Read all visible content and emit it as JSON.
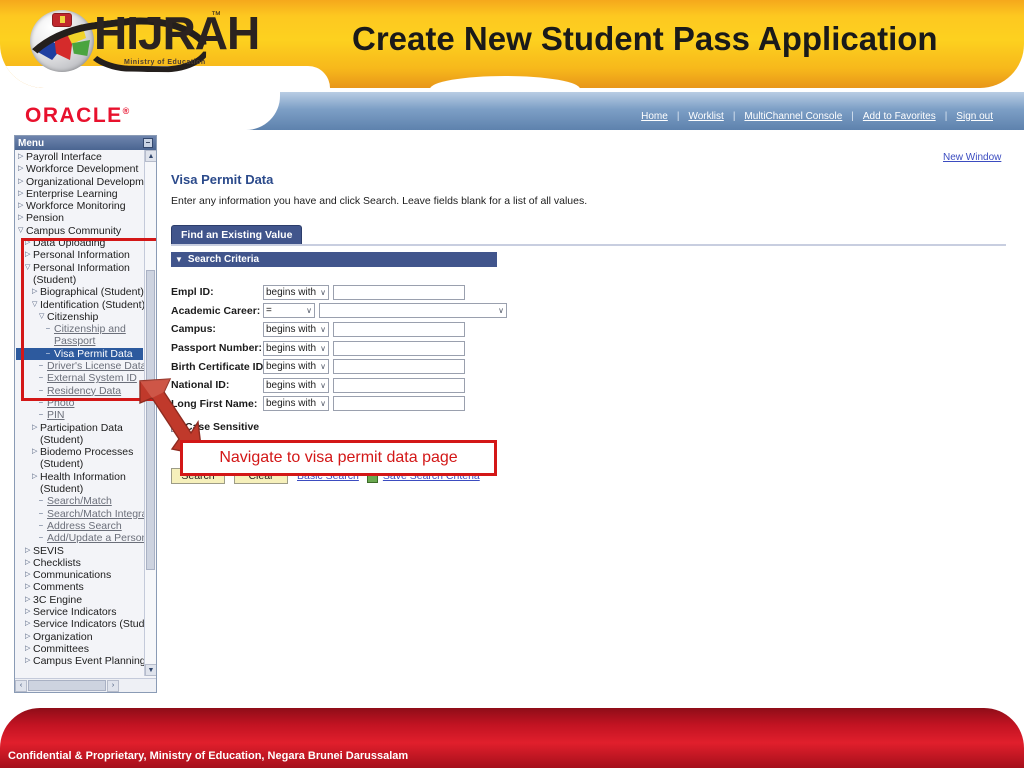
{
  "banner": {
    "title": "Create New Student Pass Application",
    "logo_text": "HIJRAH",
    "logo_tm": "™",
    "logo_sub": "Ministry of Education"
  },
  "oracle_bar": {
    "brand": "ORACLE",
    "brand_mark": "®",
    "links": [
      "Home",
      "Worklist",
      "MultiChannel Console",
      "Add to Favorites",
      "Sign out"
    ],
    "separator": "|"
  },
  "sidebar": {
    "header": "Menu",
    "collapse_glyph": "–",
    "scroll_up_glyph": "▲",
    "scroll_down_glyph": "▼",
    "hscroll_left_glyph": "‹",
    "hscroll_right_glyph": "›",
    "items": [
      {
        "label": "Payroll Interface",
        "indent": 1,
        "twisty": "▷",
        "kind": "node"
      },
      {
        "label": "Workforce Development",
        "indent": 1,
        "twisty": "▷",
        "kind": "node"
      },
      {
        "label": "Organizational Development",
        "indent": 1,
        "twisty": "▷",
        "kind": "node"
      },
      {
        "label": "Enterprise Learning",
        "indent": 1,
        "twisty": "▷",
        "kind": "node"
      },
      {
        "label": "Workforce Monitoring",
        "indent": 1,
        "twisty": "▷",
        "kind": "node"
      },
      {
        "label": "Pension",
        "indent": 1,
        "twisty": "▷",
        "kind": "node"
      },
      {
        "label": "Campus Community",
        "indent": 1,
        "twisty": "▽",
        "kind": "node"
      },
      {
        "label": "Data Uploading",
        "indent": 2,
        "twisty": "▷",
        "kind": "node"
      },
      {
        "label": "Personal Information",
        "indent": 2,
        "twisty": "▷",
        "kind": "node"
      },
      {
        "label": "Personal Information (Student)",
        "indent": 2,
        "twisty": "▽",
        "kind": "node",
        "wrap": true
      },
      {
        "label": "Biographical (Student)",
        "indent": 3,
        "twisty": "▷",
        "kind": "node"
      },
      {
        "label": "Identification (Student)",
        "indent": 3,
        "twisty": "▽",
        "kind": "node"
      },
      {
        "label": "Citizenship",
        "indent": 4,
        "twisty": "▽",
        "kind": "node"
      },
      {
        "label": "Citizenship and Passport",
        "indent": 5,
        "twisty": "–",
        "kind": "link",
        "wrap": true
      },
      {
        "label": "Visa Permit Data",
        "indent": 5,
        "twisty": "–",
        "kind": "selected"
      },
      {
        "label": "Driver's License Data",
        "indent": 4,
        "twisty": "–",
        "kind": "link"
      },
      {
        "label": "External System ID",
        "indent": 4,
        "twisty": "–",
        "kind": "link"
      },
      {
        "label": "Residency Data",
        "indent": 4,
        "twisty": "–",
        "kind": "link"
      },
      {
        "label": "Photo",
        "indent": 4,
        "twisty": "–",
        "kind": "link"
      },
      {
        "label": "PIN",
        "indent": 4,
        "twisty": "–",
        "kind": "link"
      },
      {
        "label": "Participation Data (Student)",
        "indent": 3,
        "twisty": "▷",
        "kind": "node",
        "wrap": true
      },
      {
        "label": "Biodemo Processes (Student)",
        "indent": 3,
        "twisty": "▷",
        "kind": "node",
        "wrap": true
      },
      {
        "label": "Health Information (Student)",
        "indent": 3,
        "twisty": "▷",
        "kind": "node",
        "wrap": true
      },
      {
        "label": "Search/Match",
        "indent": 4,
        "twisty": "–",
        "kind": "link"
      },
      {
        "label": "Search/Match Integrated",
        "indent": 4,
        "twisty": "–",
        "kind": "link"
      },
      {
        "label": "Address Search",
        "indent": 4,
        "twisty": "–",
        "kind": "link"
      },
      {
        "label": "Add/Update a Person",
        "indent": 4,
        "twisty": "–",
        "kind": "link"
      },
      {
        "label": "SEVIS",
        "indent": 2,
        "twisty": "▷",
        "kind": "node"
      },
      {
        "label": "Checklists",
        "indent": 2,
        "twisty": "▷",
        "kind": "node"
      },
      {
        "label": "Communications",
        "indent": 2,
        "twisty": "▷",
        "kind": "node"
      },
      {
        "label": "Comments",
        "indent": 2,
        "twisty": "▷",
        "kind": "node"
      },
      {
        "label": "3C Engine",
        "indent": 2,
        "twisty": "▷",
        "kind": "node"
      },
      {
        "label": "Service Indicators",
        "indent": 2,
        "twisty": "▷",
        "kind": "node"
      },
      {
        "label": "Service Indicators (Student)",
        "indent": 2,
        "twisty": "▷",
        "kind": "node"
      },
      {
        "label": "Organization",
        "indent": 2,
        "twisty": "▷",
        "kind": "node"
      },
      {
        "label": "Committees",
        "indent": 2,
        "twisty": "▷",
        "kind": "node"
      },
      {
        "label": "Campus Event Planning",
        "indent": 2,
        "twisty": "▷",
        "kind": "node"
      }
    ]
  },
  "main": {
    "new_window": "New Window",
    "page_title": "Visa Permit Data",
    "instructions": "Enter any information you have and click Search. Leave fields blank for a list of all values.",
    "tab_label": "Find an Existing Value",
    "criteria_header": "Search Criteria",
    "criteria_triangle": "▼",
    "fields": [
      {
        "label": "Empl ID:",
        "operator": "begins with",
        "value": "",
        "second_select": false
      },
      {
        "label": "Academic Career:",
        "operator": "=",
        "value": "",
        "second_select": true
      },
      {
        "label": "Campus:",
        "operator": "begins with",
        "value": "",
        "second_select": false
      },
      {
        "label": "Passport Number:",
        "operator": "begins with",
        "value": "",
        "second_select": false
      },
      {
        "label": "Birth Certificate ID:",
        "operator": "begins with",
        "value": "",
        "second_select": false
      },
      {
        "label": "National ID:",
        "operator": "begins with",
        "value": "",
        "second_select": false
      },
      {
        "label": "Long First Name:",
        "operator": "begins with",
        "value": "",
        "second_select": false
      }
    ],
    "case_sensitive_label": "Case Sensitive",
    "case_sensitive_checked": false,
    "search_button": "Search",
    "clear_button": "Clear",
    "basic_search_link": "Basic Search",
    "save_search_link": "Save Search Criteria",
    "dropdown_glyph": "∨"
  },
  "annotation": {
    "text": "Navigate to visa permit data page",
    "color": "#d31717"
  },
  "footer": {
    "text": "Confidential & Proprietary, Ministry of Education, Negara Brunei Darussalam"
  }
}
